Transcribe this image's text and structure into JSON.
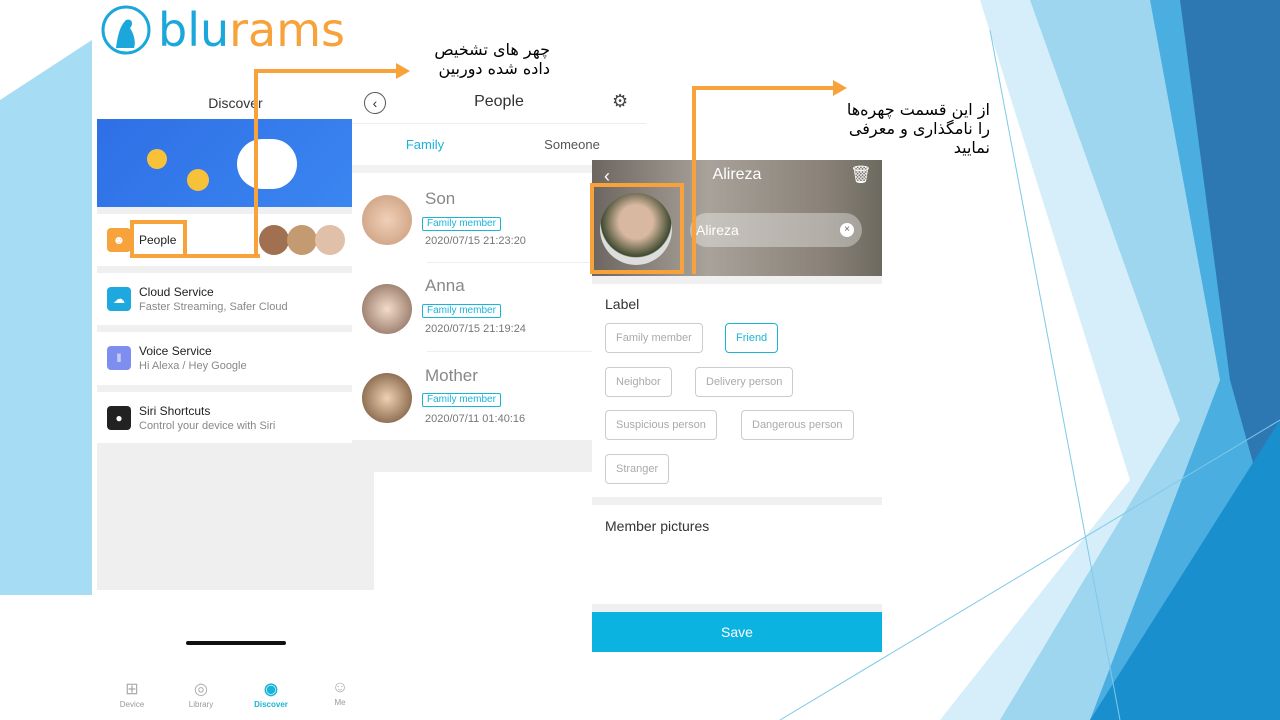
{
  "logo": {
    "text_blu": "blu",
    "text_rams": "rams"
  },
  "annotations": {
    "faces_detected": [
      "چهر های تشخیص",
      "داده شده دوربین"
    ],
    "name_faces": [
      "از این قسمت چهره‌ها",
      "را نامگذاری و معرفی",
      "نمایید"
    ]
  },
  "discover": {
    "title": "Discover",
    "rows": [
      {
        "icon": "person-icon",
        "title": "People",
        "color": "#f7a23a"
      },
      {
        "icon": "cloud-icon",
        "title": "Cloud Service",
        "subtitle": "Faster Streaming, Safer Cloud",
        "color": "#1da8e0"
      },
      {
        "icon": "voice-icon",
        "title": "Voice Service",
        "subtitle": "Hi Alexa / Hey Google",
        "color": "#7d8ef0"
      },
      {
        "icon": "siri-icon",
        "title": "Siri Shortcuts",
        "subtitle": "Control your device with Siri",
        "color": "#222"
      }
    ],
    "nav": [
      {
        "label": "Device",
        "icon": "device-icon",
        "active": false
      },
      {
        "label": "Library",
        "icon": "library-icon",
        "active": false
      },
      {
        "label": "Discover",
        "icon": "discover-icon",
        "active": true
      },
      {
        "label": "Me",
        "icon": "me-icon",
        "active": false
      }
    ]
  },
  "people": {
    "title": "People",
    "tabs": [
      "Family",
      "Someone"
    ],
    "items": [
      {
        "name": "Son",
        "badge": "Family member",
        "date": "2020/07/15 21:23:20"
      },
      {
        "name": "Anna",
        "badge": "Family member",
        "date": "2020/07/15 21:19:24"
      },
      {
        "name": "Mother",
        "badge": "Family member",
        "date": "2020/07/11 01:40:16"
      }
    ]
  },
  "edit": {
    "title": "Alireza",
    "name_value": "Alireza",
    "label_heading": "Label",
    "labels": [
      {
        "text": "Family member",
        "selected": false
      },
      {
        "text": "Friend",
        "selected": true
      },
      {
        "text": "Neighbor",
        "selected": false
      },
      {
        "text": "Delivery person",
        "selected": false
      },
      {
        "text": "Suspicious person",
        "selected": false
      },
      {
        "text": "Dangerous person",
        "selected": false
      },
      {
        "text": "Stranger",
        "selected": false
      }
    ],
    "pictures_heading": "Member pictures",
    "save": "Save"
  },
  "colors": {
    "accent": "#1ab4d8",
    "annotation": "#f7a23a",
    "save": "#0bb3e0"
  }
}
